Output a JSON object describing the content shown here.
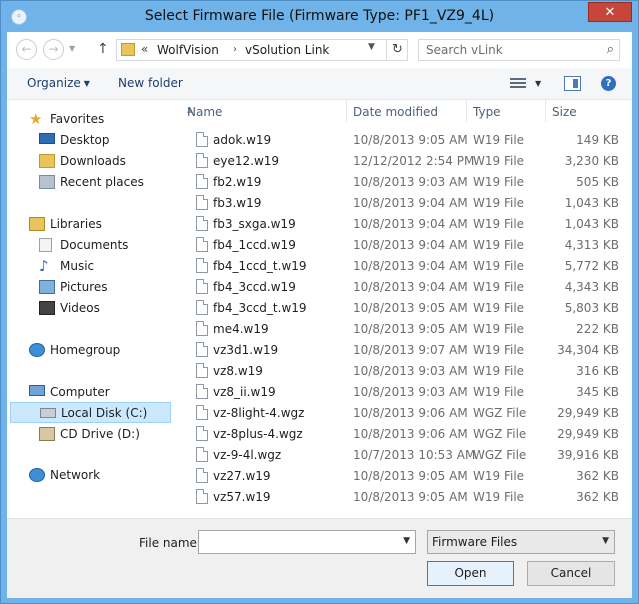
{
  "window": {
    "title": "Select Firmware File (Firmware Type: PF1_VZ9_4L)",
    "close_glyph": "✕"
  },
  "nav": {
    "crumb_overflow": "«",
    "breadcrumb": [
      "WolfVision",
      "vSolution Link"
    ],
    "search_placeholder": "Search vLink"
  },
  "toolbar": {
    "organize_label": "Organize",
    "new_folder_label": "New folder"
  },
  "sidebar": {
    "favorites": "Favorites",
    "desktop": "Desktop",
    "downloads": "Downloads",
    "recent_places": "Recent places",
    "libraries": "Libraries",
    "documents": "Documents",
    "music": "Music",
    "pictures": "Pictures",
    "videos": "Videos",
    "homegroup": "Homegroup",
    "computer": "Computer",
    "local_disk": "Local Disk (C:)",
    "cd_drive": "CD Drive (D:)",
    "network": "Network"
  },
  "columns": {
    "name": "Name",
    "date": "Date modified",
    "type": "Type",
    "size": "Size"
  },
  "files": [
    {
      "name": "adok.w19",
      "date": "10/8/2013 9:05 AM",
      "type": "W19 File",
      "size": "149 KB"
    },
    {
      "name": "eye12.w19",
      "date": "12/12/2012 2:54 PM",
      "type": "W19 File",
      "size": "3,230 KB"
    },
    {
      "name": "fb2.w19",
      "date": "10/8/2013 9:03 AM",
      "type": "W19 File",
      "size": "505 KB"
    },
    {
      "name": "fb3.w19",
      "date": "10/8/2013 9:04 AM",
      "type": "W19 File",
      "size": "1,043 KB"
    },
    {
      "name": "fb3_sxga.w19",
      "date": "10/8/2013 9:04 AM",
      "type": "W19 File",
      "size": "1,043 KB"
    },
    {
      "name": "fb4_1ccd.w19",
      "date": "10/8/2013 9:04 AM",
      "type": "W19 File",
      "size": "4,313 KB"
    },
    {
      "name": "fb4_1ccd_t.w19",
      "date": "10/8/2013 9:04 AM",
      "type": "W19 File",
      "size": "5,772 KB"
    },
    {
      "name": "fb4_3ccd.w19",
      "date": "10/8/2013 9:04 AM",
      "type": "W19 File",
      "size": "4,343 KB"
    },
    {
      "name": "fb4_3ccd_t.w19",
      "date": "10/8/2013 9:05 AM",
      "type": "W19 File",
      "size": "5,803 KB"
    },
    {
      "name": "me4.w19",
      "date": "10/8/2013 9:05 AM",
      "type": "W19 File",
      "size": "222 KB"
    },
    {
      "name": "vz3d1.w19",
      "date": "10/8/2013 9:07 AM",
      "type": "W19 File",
      "size": "34,304 KB"
    },
    {
      "name": "vz8.w19",
      "date": "10/8/2013 9:03 AM",
      "type": "W19 File",
      "size": "316 KB"
    },
    {
      "name": "vz8_ii.w19",
      "date": "10/8/2013 9:03 AM",
      "type": "W19 File",
      "size": "345 KB"
    },
    {
      "name": "vz-8light-4.wgz",
      "date": "10/8/2013 9:06 AM",
      "type": "WGZ File",
      "size": "29,949 KB"
    },
    {
      "name": "vz-8plus-4.wgz",
      "date": "10/8/2013 9:06 AM",
      "type": "WGZ File",
      "size": "29,949 KB"
    },
    {
      "name": "vz-9-4l.wgz",
      "date": "10/7/2013 10:53 AM",
      "type": "WGZ File",
      "size": "39,916 KB"
    },
    {
      "name": "vz27.w19",
      "date": "10/8/2013 9:05 AM",
      "type": "W19 File",
      "size": "362 KB"
    },
    {
      "name": "vz57.w19",
      "date": "10/8/2013 9:05 AM",
      "type": "W19 File",
      "size": "362 KB"
    }
  ],
  "bottom": {
    "file_name_label": "File name:",
    "file_name_value": "",
    "file_type_selected": "Firmware Files",
    "open_label": "Open",
    "cancel_label": "Cancel"
  }
}
